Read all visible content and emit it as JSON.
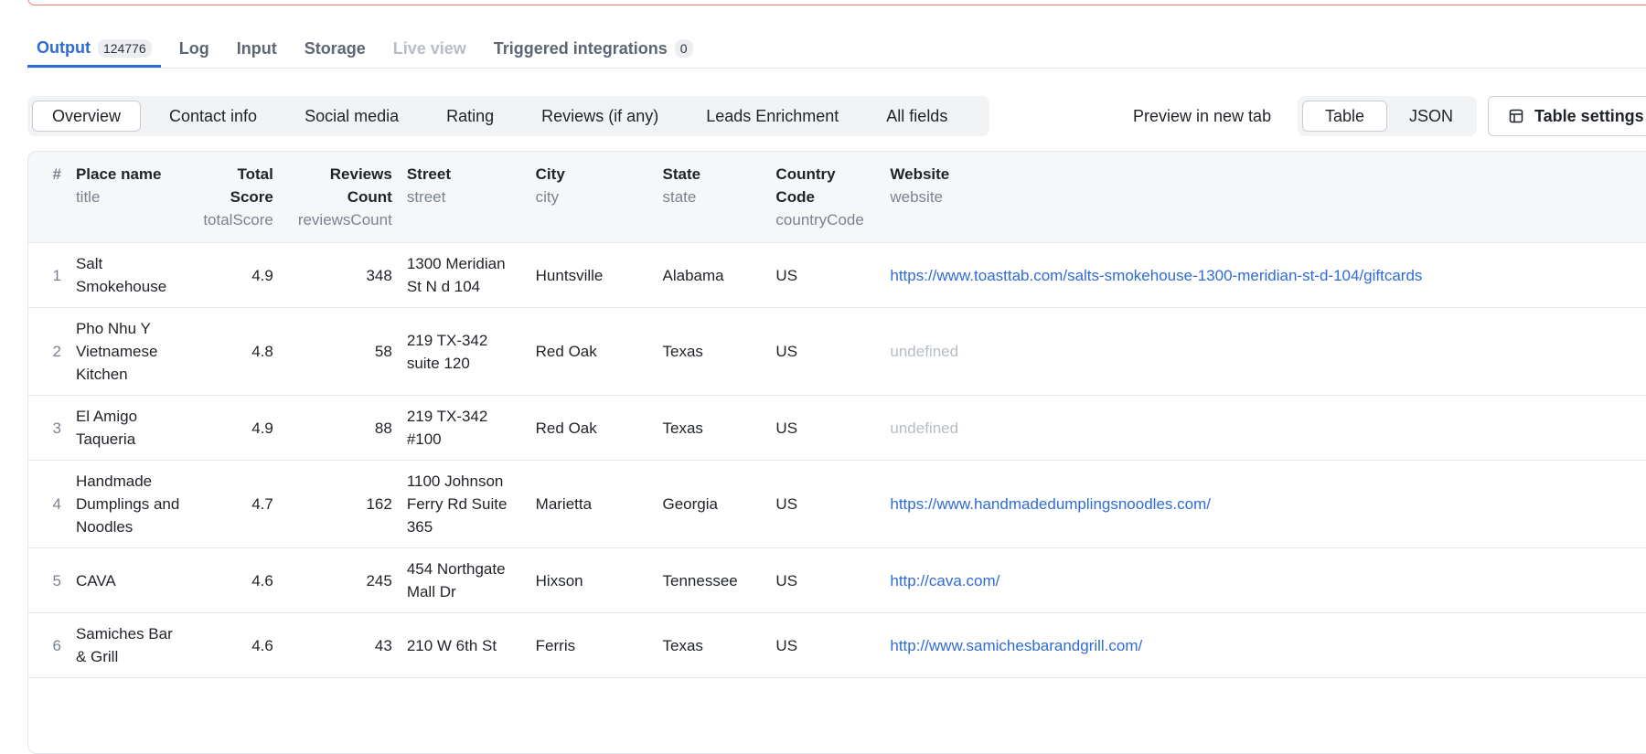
{
  "tabs": [
    {
      "label": "Output",
      "count": "124776",
      "state": "active"
    },
    {
      "label": "Log",
      "state": "normal"
    },
    {
      "label": "Input",
      "state": "normal"
    },
    {
      "label": "Storage",
      "state": "normal"
    },
    {
      "label": "Live view",
      "state": "disabled"
    },
    {
      "label": "Triggered integrations",
      "count": "0",
      "state": "normal"
    }
  ],
  "views": [
    "Overview",
    "Contact info",
    "Social media",
    "Rating",
    "Reviews (if any)",
    "Leads Enrichment",
    "All fields"
  ],
  "active_view": "Overview",
  "toolbar": {
    "preview_label": "Preview in new tab",
    "formats": [
      "Table",
      "JSON"
    ],
    "active_format": "Table",
    "settings_label": "Table settings",
    "settings_icon": "table-icon"
  },
  "table": {
    "columns": [
      {
        "key": "idx",
        "label": "#",
        "sub": "",
        "align": "idx"
      },
      {
        "key": "title",
        "label": "Place name",
        "sub": "title"
      },
      {
        "key": "totalScore",
        "label": "Total Score",
        "sub": "totalScore",
        "align": "num"
      },
      {
        "key": "reviewsCount",
        "label": "Reviews Count",
        "sub": "reviewsCount",
        "align": "num"
      },
      {
        "key": "street",
        "label": "Street",
        "sub": "street"
      },
      {
        "key": "city",
        "label": "City",
        "sub": "city"
      },
      {
        "key": "state",
        "label": "State",
        "sub": "state"
      },
      {
        "key": "countryCode",
        "label": "Country Code",
        "sub": "countryCode"
      },
      {
        "key": "website",
        "label": "Website",
        "sub": "website"
      }
    ],
    "rows": [
      {
        "idx": "1",
        "title": "Salt Smokehouse",
        "totalScore": "4.9",
        "reviewsCount": "348",
        "street": "1300 Meridian St N d 104",
        "city": "Huntsville",
        "state": "Alabama",
        "countryCode": "US",
        "website": "https://www.toasttab.com/salts-smokehouse-1300-meridian-st-d-104/giftcards"
      },
      {
        "idx": "2",
        "title": "Pho Nhu Y Vietnamese Kitchen",
        "totalScore": "4.8",
        "reviewsCount": "58",
        "street": "219 TX-342 suite 120",
        "city": "Red Oak",
        "state": "Texas",
        "countryCode": "US",
        "website": "undefined"
      },
      {
        "idx": "3",
        "title": "El Amigo Taqueria",
        "totalScore": "4.9",
        "reviewsCount": "88",
        "street": "219 TX-342 #100",
        "city": "Red Oak",
        "state": "Texas",
        "countryCode": "US",
        "website": "undefined"
      },
      {
        "idx": "4",
        "title": "Handmade Dumplings and Noodles",
        "totalScore": "4.7",
        "reviewsCount": "162",
        "street": "1100 Johnson Ferry Rd Suite 365",
        "city": "Marietta",
        "state": "Georgia",
        "countryCode": "US",
        "website": "https://www.handmadedumplingsnoodles.com/"
      },
      {
        "idx": "5",
        "title": "CAVA",
        "totalScore": "4.6",
        "reviewsCount": "245",
        "street": "454 Northgate Mall Dr",
        "city": "Hixson",
        "state": "Tennessee",
        "countryCode": "US",
        "website": "http://cava.com/"
      },
      {
        "idx": "6",
        "title": "Samiches Bar & Grill",
        "totalScore": "4.6",
        "reviewsCount": "43",
        "street": "210 W 6th St",
        "city": "Ferris",
        "state": "Texas",
        "countryCode": "US",
        "website": "http://www.samichesbarandgrill.com/"
      }
    ]
  }
}
